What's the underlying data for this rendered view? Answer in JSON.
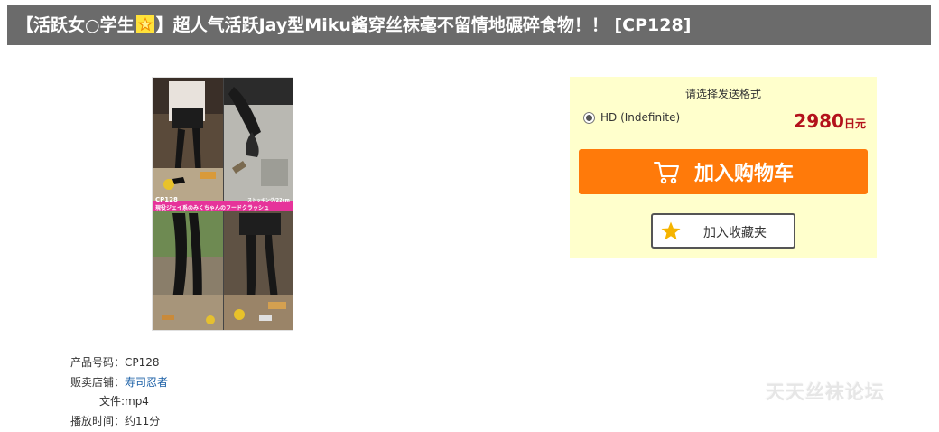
{
  "header": {
    "title_part1": "【活跃女○学生",
    "title_part2": "】超人气活跃Jay型Miku酱穿丝袜毫不留情地碾碎食物！！ [CP128]",
    "badge_icon": "star-badge-icon"
  },
  "product_image": {
    "icon": "product-thumbnail-image",
    "banner_code": "CP128",
    "banner_right_text": "ストッキング/22cm",
    "banner_caption": "現役ジェイ系のみくちゃんのフードクラッシュ"
  },
  "details": {
    "product_code_label": "产品号码：",
    "product_code_value": "CP128",
    "shop_label": "贩卖店铺：",
    "shop_value": "寿司忍者",
    "file_label": "文件:",
    "file_value": "mp4",
    "duration_label": "播放时间：",
    "duration_value": "约11分"
  },
  "purchase": {
    "format_heading": "请选择发送格式",
    "format_option": "HD (Indefinite)",
    "price_amount": "2980",
    "price_unit": "日元",
    "cart_button_label": "加入购物车",
    "favorite_button_label": "加入收藏夹"
  },
  "watermark": {
    "text": "天天丝袜论坛"
  },
  "colors": {
    "title_bg": "#6b6b6b",
    "purchase_bg": "#ffffcc",
    "cart_orange": "#ff7a0a",
    "price_red": "#b3121b",
    "link_blue": "#1a5fa6",
    "star_gold": "#f5b400"
  }
}
